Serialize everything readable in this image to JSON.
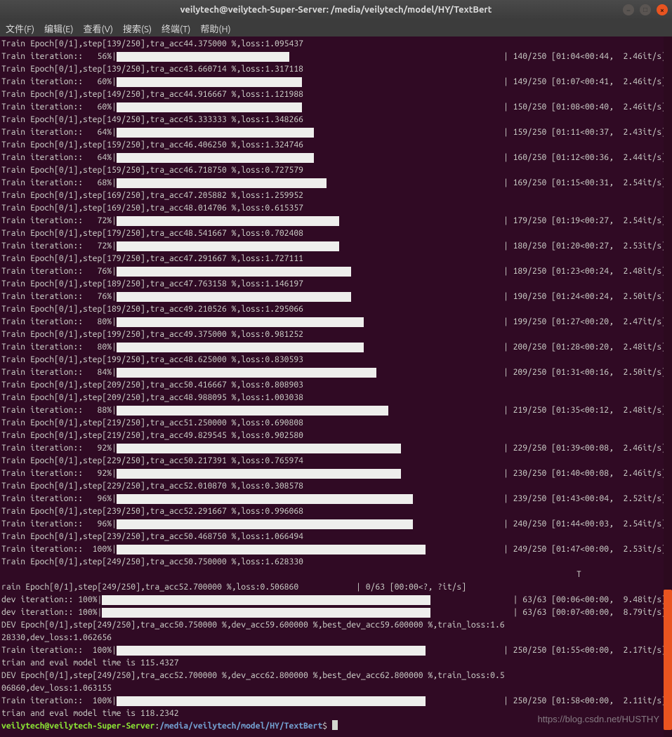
{
  "window": {
    "title": "veilytech@veilytech-Super-Server: /media/veilytech/model/HY/TextBert"
  },
  "menu": {
    "file": "文件(F)",
    "edit": "编辑(E)",
    "view": "查看(V)",
    "search": "搜索(S)",
    "terminal": "终端(T)",
    "help": "帮助(H)"
  },
  "prompt": {
    "user": "veilytech@veilytech-Super-Server",
    "colon": ":",
    "path": "/media/veilytech/model/HY/TextBert",
    "dollar": "$ "
  },
  "watermark": "https://blog.csdn.net/HUSTHY",
  "lines": [
    {
      "type": "epoch",
      "text": "Train Epoch[0/1],step[139/250],tra_acc44.375000 %,loss:1.095437"
    },
    {
      "type": "iter",
      "pct": "56",
      "bar": 246,
      "right": "| 140/250 [01:04<00:44,  2.46it/s]"
    },
    {
      "type": "epoch",
      "text": "Train Epoch[0/1],step[139/250],tra_acc43.660714 %,loss:1.317118"
    },
    {
      "type": "iter",
      "pct": "60",
      "bar": 264,
      "right": "| 149/250 [01:07<00:41,  2.46it/s]"
    },
    {
      "type": "epoch",
      "text": "Train Epoch[0/1],step[149/250],tra_acc44.916667 %,loss:1.121988"
    },
    {
      "type": "iter",
      "pct": "60",
      "bar": 264,
      "right": "| 150/250 [01:08<00:40,  2.46it/s]"
    },
    {
      "type": "epoch",
      "text": "Train Epoch[0/1],step[149/250],tra_acc45.333333 %,loss:1.348266"
    },
    {
      "type": "iter",
      "pct": "64",
      "bar": 281,
      "right": "| 159/250 [01:11<00:37,  2.43it/s]"
    },
    {
      "type": "epoch",
      "text": "Train Epoch[0/1],step[159/250],tra_acc46.406250 %,loss:1.324746"
    },
    {
      "type": "iter",
      "pct": "64",
      "bar": 281,
      "right": "| 160/250 [01:12<00:36,  2.44it/s]"
    },
    {
      "type": "epoch",
      "text": "Train Epoch[0/1],step[159/250],tra_acc46.718750 %,loss:0.727579"
    },
    {
      "type": "iter",
      "pct": "68",
      "bar": 299,
      "right": "| 169/250 [01:15<00:31,  2.54it/s]"
    },
    {
      "type": "epoch",
      "text": "Train Epoch[0/1],step[169/250],tra_acc47.205882 %,loss:1.259952"
    },
    {
      "type": "epoch",
      "text": "Train Epoch[0/1],step[169/250],tra_acc48.014706 %,loss:0.615357"
    },
    {
      "type": "iter",
      "pct": "72",
      "bar": 317,
      "right": "| 179/250 [01:19<00:27,  2.54it/s]"
    },
    {
      "type": "epoch",
      "text": "Train Epoch[0/1],step[179/250],tra_acc48.541667 %,loss:0.702408"
    },
    {
      "type": "iter",
      "pct": "72",
      "bar": 317,
      "right": "| 180/250 [01:20<00:27,  2.53it/s]"
    },
    {
      "type": "epoch",
      "text": "Train Epoch[0/1],step[179/250],tra_acc47.291667 %,loss:1.727111"
    },
    {
      "type": "iter",
      "pct": "76",
      "bar": 334,
      "right": "| 189/250 [01:23<00:24,  2.48it/s]"
    },
    {
      "type": "epoch",
      "text": "Train Epoch[0/1],step[189/250],tra_acc47.763158 %,loss:1.146197"
    },
    {
      "type": "iter",
      "pct": "76",
      "bar": 334,
      "right": "| 190/250 [01:24<00:24,  2.50it/s]"
    },
    {
      "type": "epoch",
      "text": "Train Epoch[0/1],step[189/250],tra_acc49.210526 %,loss:1.295066"
    },
    {
      "type": "iter",
      "pct": "80",
      "bar": 352,
      "right": "| 199/250 [01:27<00:20,  2.47it/s]"
    },
    {
      "type": "epoch",
      "text": "Train Epoch[0/1],step[199/250],tra_acc49.375000 %,loss:0.981252"
    },
    {
      "type": "iter",
      "pct": "80",
      "bar": 352,
      "right": "| 200/250 [01:28<00:20,  2.48it/s]"
    },
    {
      "type": "epoch",
      "text": "Train Epoch[0/1],step[199/250],tra_acc48.625000 %,loss:0.830593"
    },
    {
      "type": "iter",
      "pct": "84",
      "bar": 370,
      "right": "| 209/250 [01:31<00:16,  2.50it/s]"
    },
    {
      "type": "epoch",
      "text": "Train Epoch[0/1],step[209/250],tra_acc50.416667 %,loss:0.808903"
    },
    {
      "type": "epoch",
      "text": "Train Epoch[0/1],step[209/250],tra_acc48.988095 %,loss:1.003038"
    },
    {
      "type": "iter",
      "pct": "88",
      "bar": 387,
      "right": "| 219/250 [01:35<00:12,  2.48it/s]"
    },
    {
      "type": "epoch",
      "text": "Train Epoch[0/1],step[219/250],tra_acc51.250000 %,loss:0.690808"
    },
    {
      "type": "epoch",
      "text": "Train Epoch[0/1],step[219/250],tra_acc49.829545 %,loss:0.902580"
    },
    {
      "type": "iter",
      "pct": "92",
      "bar": 405,
      "right": "| 229/250 [01:39<00:08,  2.46it/s]"
    },
    {
      "type": "epoch",
      "text": "Train Epoch[0/1],step[229/250],tra_acc50.217391 %,loss:0.765974"
    },
    {
      "type": "iter",
      "pct": "92",
      "bar": 405,
      "right": "| 230/250 [01:40<00:08,  2.46it/s]"
    },
    {
      "type": "epoch",
      "text": "Train Epoch[0/1],step[229/250],tra_acc52.010870 %,loss:0.308578"
    },
    {
      "type": "iter",
      "pct": "96",
      "bar": 422,
      "right": "| 239/250 [01:43<00:04,  2.52it/s]"
    },
    {
      "type": "epoch",
      "text": "Train Epoch[0/1],step[239/250],tra_acc52.291667 %,loss:0.996068"
    },
    {
      "type": "iter",
      "pct": "96",
      "bar": 422,
      "right": "| 240/250 [01:44<00:03,  2.54it/s]"
    },
    {
      "type": "epoch",
      "text": "Train Epoch[0/1],step[239/250],tra_acc50.468750 %,loss:1.066494"
    },
    {
      "type": "iter",
      "pct": "100",
      "bar": 440,
      "right": "| 249/250 [01:47<00:00,  2.53it/s]"
    },
    {
      "type": "epoch",
      "text": "Train Epoch[0/1],step[249/250],tra_acc50.750000 %,loss:1.628330"
    },
    {
      "type": "plain",
      "text": "                                                                                                                        T"
    },
    {
      "type": "plain",
      "text": "rain Epoch[0/1],step[249/250],tra_acc52.700000 %,loss:0.506860            | 0/63 [00:00<?, ?it/s]"
    },
    {
      "type": "dev",
      "pct": "100",
      "bar": 468,
      "right": "| 63/63 [00:06<00:00,  9.48it/s]"
    },
    {
      "type": "dev",
      "pct": "100",
      "bar": 468,
      "right": "| 63/63 [00:07<00:00,  8.79it/s]"
    },
    {
      "type": "plain",
      "text": "DEV Epoch[0/1],step[249/250],tra_acc50.750000 %,dev_acc59.600000 %,best_dev_acc59.600000 %,train_loss:1.6"
    },
    {
      "type": "plain",
      "text": "28330,dev_loss:1.062656"
    },
    {
      "type": "iter",
      "pct": "100",
      "bar": 440,
      "right": "| 250/250 [01:55<00:00,  2.17it/s]"
    },
    {
      "type": "plain",
      "text": "trian and eval model time is 115.4327"
    },
    {
      "type": "plain",
      "text": "DEV Epoch[0/1],step[249/250],tra_acc52.700000 %,dev_acc62.800000 %,best_dev_acc62.800000 %,train_loss:0.5"
    },
    {
      "type": "plain",
      "text": "06860,dev_loss:1.063155"
    },
    {
      "type": "iter",
      "pct": "100",
      "bar": 440,
      "right": "| 250/250 [01:58<00:00,  2.11it/s]"
    },
    {
      "type": "plain",
      "text": "trian and eval model time is 118.2342"
    }
  ]
}
